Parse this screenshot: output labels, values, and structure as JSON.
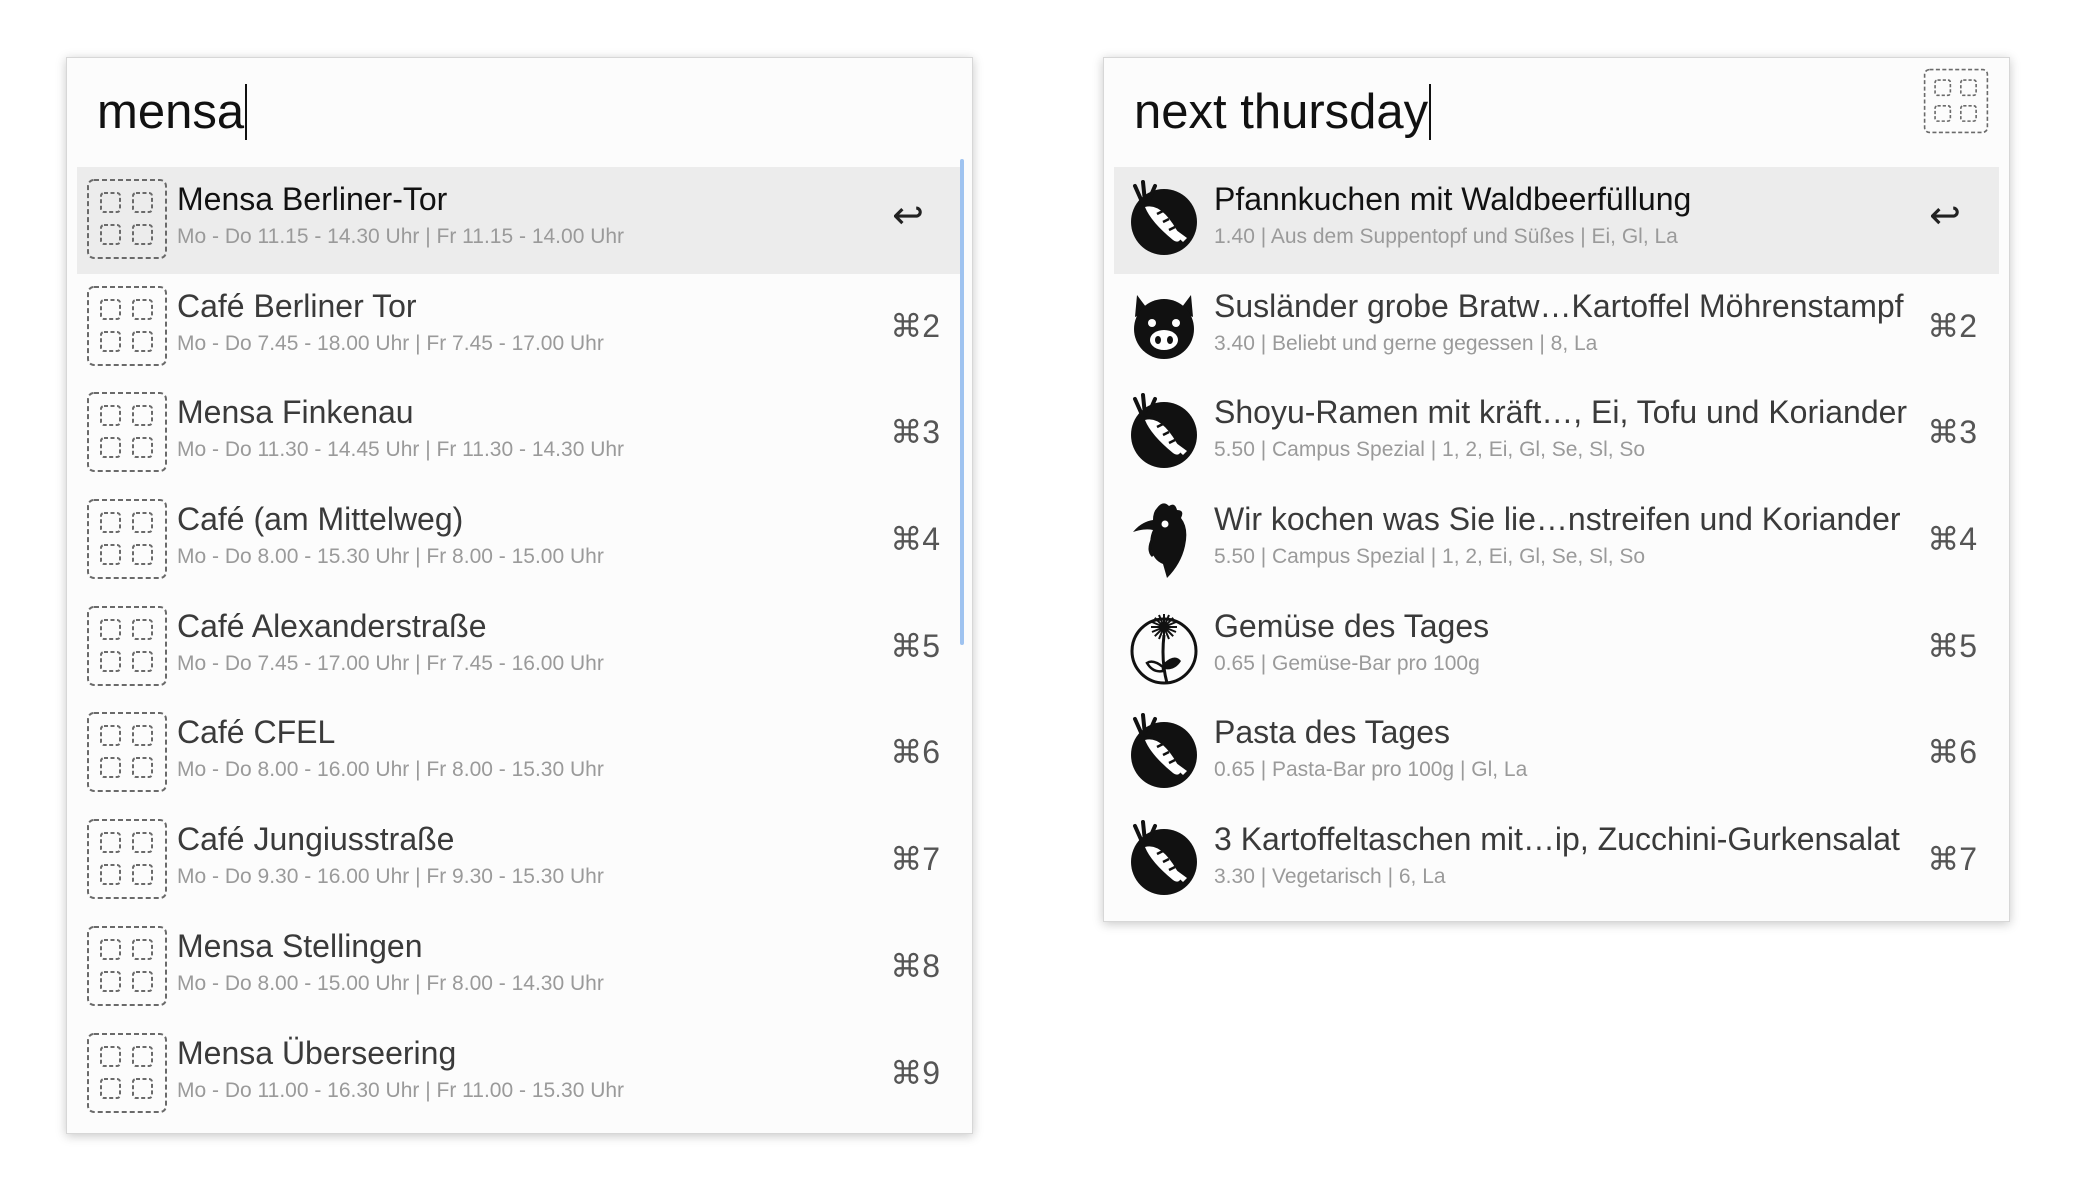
{
  "left": {
    "query": "mensa",
    "results": [
      {
        "title": "Mensa Berliner-Tor",
        "subtitle": "Mo - Do 11.15 - 14.30 Uhr | Fr 11.15 - 14.00 Uhr",
        "shortcut": "↩",
        "icon": "placeholder-grid-icon",
        "selected": true
      },
      {
        "title": "Café Berliner Tor",
        "subtitle": "Mo - Do 7.45 - 18.00 Uhr | Fr 7.45 - 17.00 Uhr",
        "shortcut": "⌘2",
        "icon": "placeholder-grid-icon"
      },
      {
        "title": "Mensa Finkenau",
        "subtitle": "Mo - Do 11.30 - 14.45 Uhr | Fr 11.30 - 14.30 Uhr",
        "shortcut": "⌘3",
        "icon": "placeholder-grid-icon"
      },
      {
        "title": "Café (am Mittelweg)",
        "subtitle": "Mo - Do 8.00 - 15.30 Uhr | Fr 8.00 - 15.00 Uhr",
        "shortcut": "⌘4",
        "icon": "placeholder-grid-icon"
      },
      {
        "title": "Café Alexanderstraße",
        "subtitle": "Mo - Do 7.45 - 17.00 Uhr | Fr 7.45 - 16.00 Uhr",
        "shortcut": "⌘5",
        "icon": "placeholder-grid-icon"
      },
      {
        "title": "Café CFEL",
        "subtitle": "Mo - Do 8.00 - 16.00 Uhr | Fr 8.00 - 15.30 Uhr",
        "shortcut": "⌘6",
        "icon": "placeholder-grid-icon"
      },
      {
        "title": "Café Jungiusstraße",
        "subtitle": "Mo - Do 9.30 - 16.00 Uhr | Fr 9.30 - 15.30 Uhr",
        "shortcut": "⌘7",
        "icon": "placeholder-grid-icon"
      },
      {
        "title": "Mensa Stellingen",
        "subtitle": "Mo - Do 8.00 - 15.00 Uhr | Fr 8.00 - 14.30 Uhr",
        "shortcut": "⌘8",
        "icon": "placeholder-grid-icon"
      },
      {
        "title": "Mensa Überseering",
        "subtitle": "Mo - Do 11.00 - 16.30 Uhr | Fr 11.00 - 15.30 Uhr",
        "shortcut": "⌘9",
        "icon": "placeholder-grid-icon"
      }
    ]
  },
  "right": {
    "query": "next thursday",
    "panel_icon": "placeholder-grid-icon",
    "results": [
      {
        "title": "Pfannkuchen mit Waldbeerfüllung",
        "subtitle": "1.40 | Aus dem Suppentopf und Süßes | Ei, Gl, La",
        "shortcut": "↩",
        "icon": "carrot-icon",
        "selected": true
      },
      {
        "title": "Susländer grobe Bratw…Kartoffel Möhrenstampf",
        "subtitle": "3.40 | Beliebt und gerne gegessen | 8, La",
        "shortcut": "⌘2",
        "icon": "pig-icon"
      },
      {
        "title": "Shoyu-Ramen mit kräft…, Ei, Tofu und Koriander",
        "subtitle": "5.50 | Campus Spezial | 1, 2, Ei, Gl, Se, Sl, So",
        "shortcut": "⌘3",
        "icon": "carrot-icon"
      },
      {
        "title": "Wir kochen was Sie lie…nstreifen und Koriander",
        "subtitle": "5.50 | Campus Spezial | 1, 2, Ei, Gl, Se, Sl, So",
        "shortcut": "⌘4",
        "icon": "chicken-icon"
      },
      {
        "title": "Gemüse des Tages",
        "subtitle": "0.65 | Gemüse-Bar pro 100g",
        "shortcut": "⌘5",
        "icon": "flower-icon"
      },
      {
        "title": "Pasta des Tages",
        "subtitle": "0.65 | Pasta-Bar pro 100g | Gl, La",
        "shortcut": "⌘6",
        "icon": "carrot-icon"
      },
      {
        "title": "3 Kartoffeltaschen mit…ip, Zucchini-Gurkensalat",
        "subtitle": "3.30 | Vegetarisch | 6, La",
        "shortcut": "⌘7",
        "icon": "carrot-icon"
      }
    ]
  }
}
